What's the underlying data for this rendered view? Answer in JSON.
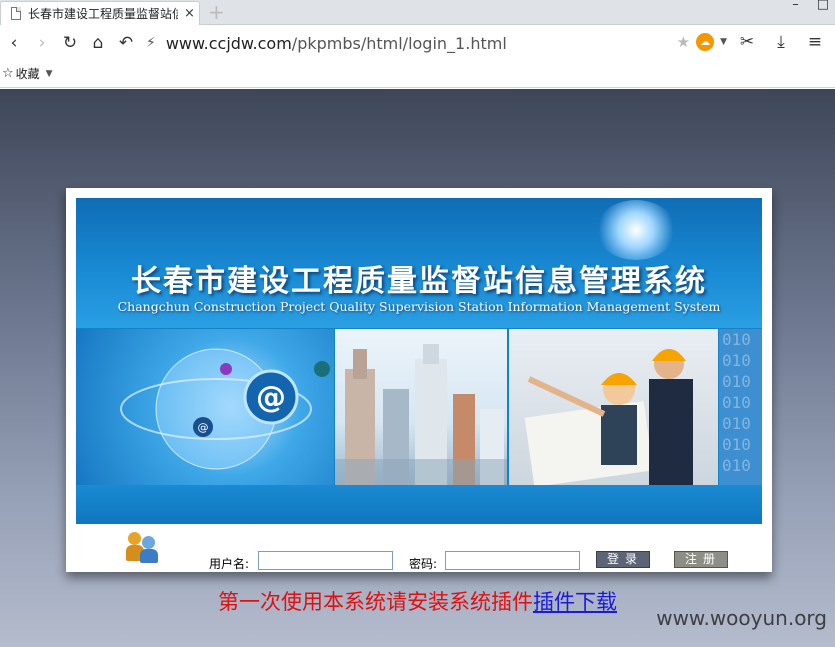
{
  "browser": {
    "tab_title": "长春市建设工程质量监督站信",
    "tab_close": "×",
    "new_tab": "+",
    "url_host": "www.ccjdw.com",
    "url_path": "/pkpmbs/html/login_1.html",
    "bookmarks_label": "收藏"
  },
  "banner": {
    "title": "长春市建设工程质量监督站信息管理系统",
    "subtitle": "Changchun  Construction Project Quality Supervision Station Information Management System",
    "binary_text": "010 010 010 010 010 010 010"
  },
  "login": {
    "username_label": "用户名:",
    "username_value": "",
    "password_label": "密码:",
    "password_value": "",
    "login_button": "登录",
    "register_button": "注册"
  },
  "notice": {
    "text": "第一次使用本系统请安装系统插件",
    "link_text": "插件下载"
  },
  "watermark": "www.wooyun.org",
  "colors": {
    "notice_red": "#e01010",
    "link_blue": "#1a1ad8",
    "banner_blue": "#1282c9"
  }
}
